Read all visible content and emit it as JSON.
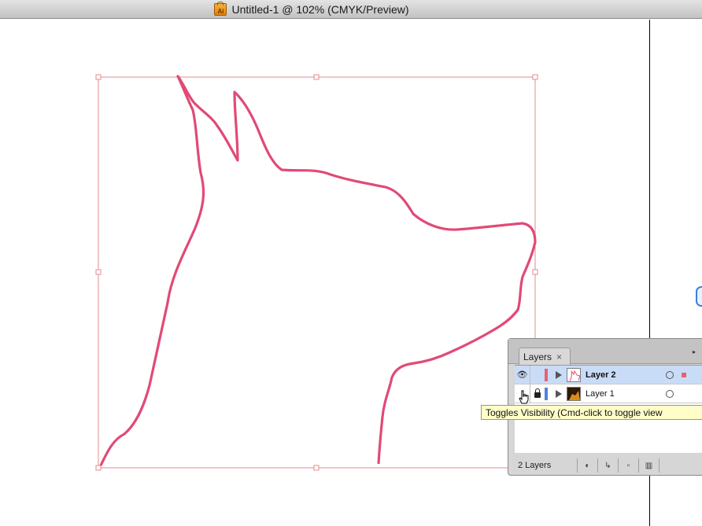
{
  "window": {
    "title": "Untitled-1 @ 102% (CMYK/Preview)",
    "icon": "illustrator-document-icon",
    "icon_label": "Ai"
  },
  "layers_panel": {
    "tab_label": "Layers",
    "close_label": "×",
    "layers": [
      {
        "name": "Layer 2",
        "visible": true,
        "locked": false,
        "color": "#e8616b",
        "selected": true
      },
      {
        "name": "Layer 1",
        "visible": false,
        "locked": true,
        "color": "#4f82e0",
        "selected": false
      }
    ],
    "eye_glyph": "👁",
    "footer_count": "2 Layers",
    "footer_buttons": [
      "make-clipping-mask-icon",
      "create-sublayer-icon",
      "new-layer-icon",
      "trash-icon"
    ]
  },
  "tooltip": {
    "text": "Toggles Visibility (Cmd-click to toggle view"
  },
  "colors": {
    "path_stroke": "#e14a76",
    "bounding_box": "#e08c8c",
    "selection_highlight": "#c9dcf7"
  }
}
